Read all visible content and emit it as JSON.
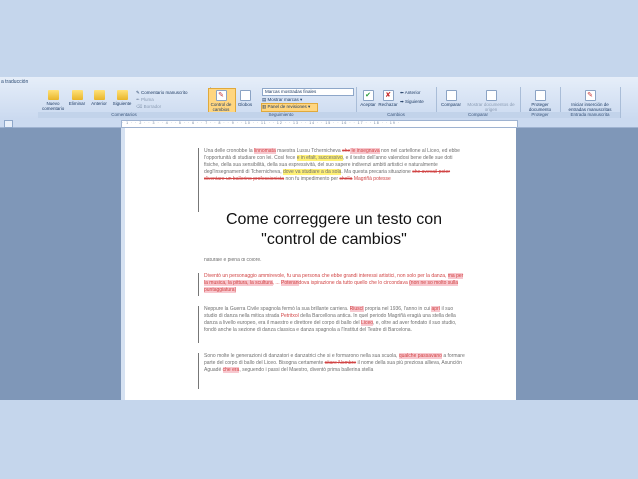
{
  "tabs": {
    "traduccion": "a traducción"
  },
  "groups": {
    "comentarios": "Comentarios",
    "seguimiento": "Seguimiento",
    "cambios": "Cambios",
    "comparar": "Comparar",
    "proteger": "Proteger",
    "entrada": "Entrada manuscrita"
  },
  "buttons": {
    "nuevo": "Nuevo comentario",
    "eliminar": "Eliminar",
    "anterior": "Anterior",
    "siguiente": "Siguiente",
    "comentario_manuscrito": "Comentario manuscrito",
    "pluma": "Pluma",
    "borrador": "Borrador",
    "control": "Control de cambios",
    "globos": "Globos",
    "marcas_dd": "Marcas mostradas finales",
    "mostrar_marcas": "Mostrar marcas",
    "panel": "Panel de revisiones",
    "aceptar": "Aceptar",
    "rechazar": "Rechazar",
    "anterior2": "Anterior",
    "siguiente2": "Siguiente",
    "comparar": "Comparar",
    "mostrar_docs": "Mostrar documentos de origen",
    "proteger": "Proteger documento",
    "iniciar": "Iniciar inserción de entradas manuscritas"
  },
  "overlay": {
    "line1": "Come correggere un testo con",
    "line2": "\"control de cambios\""
  },
  "doc": {
    "p1a": "Una delle cronobbe la ",
    "p1b": "linnomata",
    "p1c": " maestra Lussu Tchernicheva ",
    "p1d": "che",
    "p1e": " le insegnava",
    "p1f": " non nel cartellone al Liceo, ed ebbe l'opportunità di studiare con lei. Così fece ",
    "p1g": "e in efalt, successivo",
    "p1h": ", e il tesito dell'anno valendosi bene delle sue doti fisiche, della sua sensibilità, della sua espressività, del suo sapere indivenzi ambiti artistici e naturalmente degl'insegnamenti di Tchernicheva, ",
    "p1i": "dove va studiare a da sola",
    "p1j": ". Ma questa precaria situazione ",
    "p1k": "che avevail",
    "p1l": " poter diventare un ballerino professionista",
    "p1m": " non fu impedimento per ",
    "p1n": "chella",
    "p1o": " Magriñà potesse",
    "p1tail": "naturale e piena di colore.",
    "p2a": "Diventò un personaggio ammirevole, fu una persona che ebbe grandi interessi artistici, non solo per la danza, ",
    "p2b": "ma per la musica, la pittura, la scultura",
    "p2c": ", ... ",
    "p2d": "Poteran",
    "p2e": "dova ispirazione da tutto quello che lo circondava ",
    "p2f": "(non ne so molto sulla puntaggiatura)",
    "p3a": "Neppure la Guerra Civile spagnola fermò la sua brillante carriera. ",
    "p3b": "Riuscì",
    "p3c": " propria nel 1936, l'anno in cui ",
    "p3d": "aprì",
    "p3e": " il suo studio di danza nella mitica strada ",
    "p3f": "Petritxol",
    "p3g": " della Barcellona antica. In quel periodo Magriñà eragià una stella della danza a livello europeo, era il maestro e direttore del corpo di ballo del ",
    "p3h": "Liceo",
    "p3i": ", e, oltre ad aver fondato il suo studio, fondò anche la sezione di danza classica e danza spagnola a l'Institut del Teatre di Barcelona.",
    "p4a": "Sono molte le generazioni di danzatori e danzatrici che si e formarono nella sua scuola, ",
    "p4b": "qualche",
    "p4c": " passavano",
    "p4d": " a formare parte del corpo di ballo del Liceo. Bisogna certamente ",
    "p4e": "citare",
    "p4f": " Nombre",
    "p4g": " il nome della sua più preziosa allieva, Asunción Aguadé ",
    "p4h": "che era",
    "p4i": ", seguendo i passi del Maestro, diventò prima ballerina stella"
  }
}
